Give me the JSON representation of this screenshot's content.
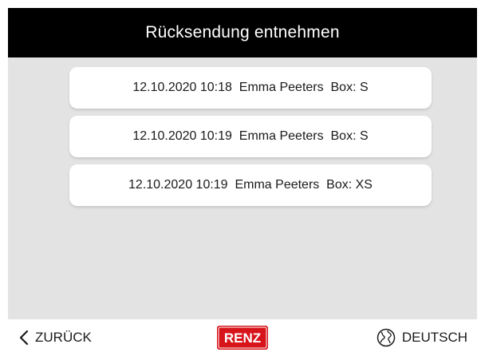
{
  "header": {
    "title": "Rücksendung entnehmen"
  },
  "returns": [
    {
      "label": "12.10.2020 10:18  Emma Peeters  Box: S"
    },
    {
      "label": "12.10.2020 10:19  Emma Peeters  Box: S"
    },
    {
      "label": "12.10.2020 10:19  Emma Peeters  Box: XS"
    }
  ],
  "footer": {
    "back_label": "ZURÜCK",
    "back_icon": "chevron-left-icon",
    "logo_text": "RENZ",
    "language_label": "DEUTSCH",
    "language_icon": "globe-icon"
  },
  "colors": {
    "header_bg": "#000000",
    "content_bg": "#e3e3e3",
    "brand_red": "#d7141a"
  }
}
